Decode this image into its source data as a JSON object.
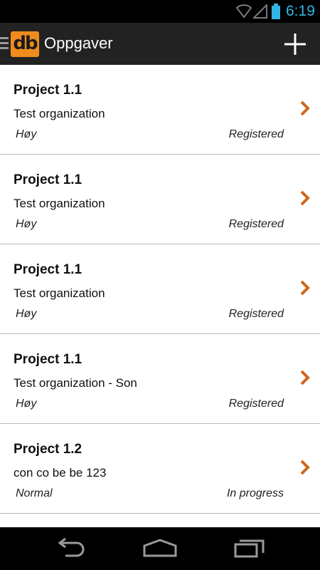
{
  "status_bar": {
    "time": "6:19",
    "icons": [
      "wifi-icon",
      "signal-icon",
      "battery-icon"
    ],
    "accent_color": "#33b5e5"
  },
  "action_bar": {
    "logo_text": "db",
    "title": "Oppgaver",
    "add_icon": "plus-icon",
    "logo_color": "#f08c1e"
  },
  "tasks": [
    {
      "project": "Project 1.1",
      "organization": "Test organization",
      "priority": "Høy",
      "status": "Registered"
    },
    {
      "project": "Project 1.1",
      "organization": "Test organization",
      "priority": "Høy",
      "status": "Registered"
    },
    {
      "project": "Project 1.1",
      "organization": "Test organization",
      "priority": "Høy",
      "status": "Registered"
    },
    {
      "project": "Project 1.1",
      "organization": "Test organization - Son",
      "priority": "Høy",
      "status": "Registered"
    },
    {
      "project": "Project 1.2",
      "organization": "con co be be 123",
      "priority": "Normal",
      "status": "In progress"
    }
  ],
  "chevron_color": "#d0661c",
  "nav_bar": {
    "icons": [
      "back-icon",
      "home-icon",
      "recent-apps-icon"
    ]
  }
}
